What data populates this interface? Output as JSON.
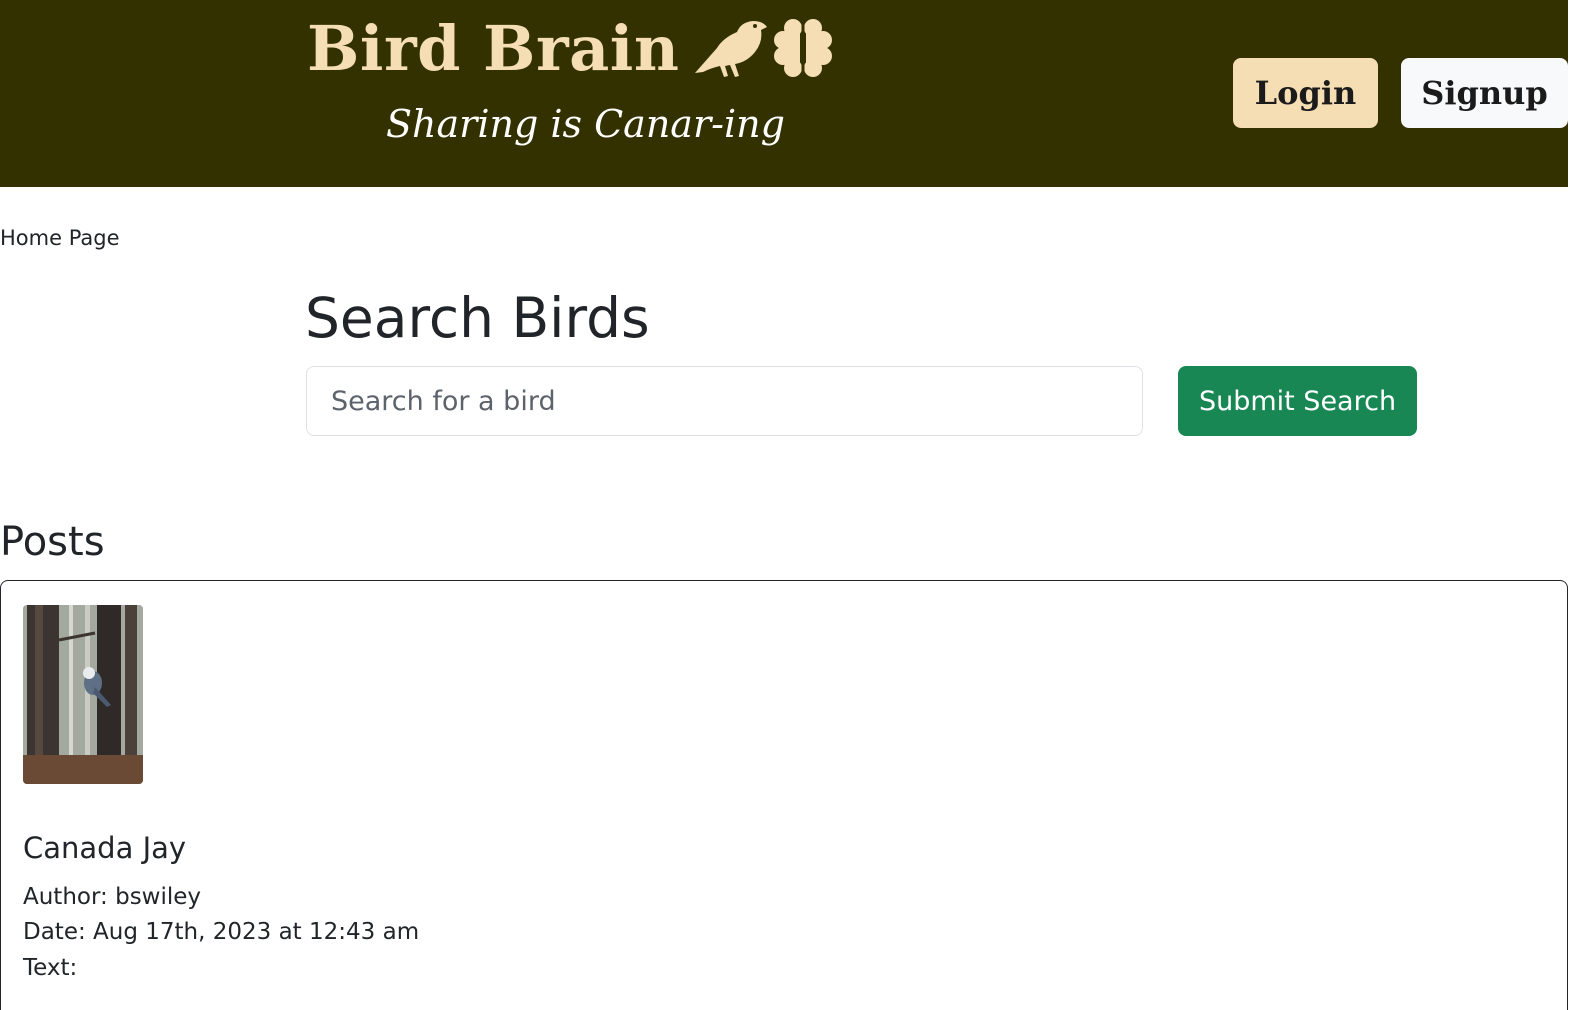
{
  "header": {
    "brand_title": "Bird Brain",
    "tagline": "Sharing is Canar-ing",
    "login_label": "Login",
    "signup_label": "Signup"
  },
  "nav": {
    "home_label": "Home Page"
  },
  "search": {
    "title": "Search Birds",
    "placeholder": "Search for a bird",
    "value": "",
    "submit_label": "Submit Search"
  },
  "posts": {
    "heading": "Posts",
    "items": [
      {
        "title": "Canada Jay",
        "author_line": "Author: bswiley",
        "date_line": "Date: Aug 17th, 2023 at 12:43 am",
        "text_line": "Text:"
      }
    ]
  },
  "icons": {
    "brand_bird": "bird-icon",
    "brand_brain": "brain-icon"
  },
  "colors": {
    "header_bg": "#333100",
    "brand_wheat": "#f5deb3",
    "submit_green": "#198754"
  }
}
